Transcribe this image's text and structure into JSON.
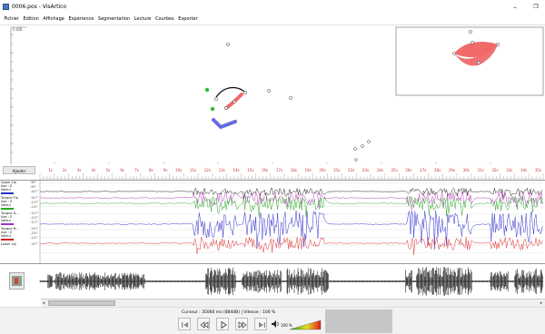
{
  "window": {
    "title": "0006.pos - VisArtico",
    "minimize_glyph": "–",
    "restore_glyph": "❐"
  },
  "menu": [
    {
      "label": "Fichier"
    },
    {
      "label": "Edition"
    },
    {
      "label": "Affichage"
    },
    {
      "label": "Expérience"
    },
    {
      "label": "Segmentation"
    },
    {
      "label": "Lecture"
    },
    {
      "label": "Courbes"
    },
    {
      "label": "Exporter"
    }
  ],
  "articulo": {
    "corner_labels": [
      "0.00",
      "1"
    ]
  },
  "timeline": {
    "add_button_label": "Ajouter",
    "ticks": [
      "1s",
      "2s",
      "3s",
      "4s",
      "5s",
      "6s",
      "7s",
      "8s",
      "9s",
      "10s",
      "11s",
      "12s",
      "13s",
      "14s",
      "15s",
      "16s",
      "17s",
      "18s",
      "19s",
      "20s",
      "21s",
      "22s",
      "23s",
      "24s",
      "25s",
      "26s",
      "27s",
      "28s",
      "29s",
      "30s",
      "31s",
      "32s",
      "33s",
      "34s",
      "35s"
    ]
  },
  "tracks": [
    {
      "label": "Upper Lip",
      "sub": "Axe : Z",
      "extra": "Valeur",
      "color": "#2233cc",
      "values": [
        "-98°",
        "-99°",
        "-101°"
      ]
    },
    {
      "label": "Tongue Tip",
      "sub": "Axe : Z",
      "extra": "Valeur",
      "color": "#22aa22",
      "values": [
        "-107°",
        "-113°",
        "-115°"
      ]
    },
    {
      "label": "Tongue D...",
      "sub": "Axe : Z",
      "extra": "Valeur",
      "color": "#9933cc",
      "values": [
        "-121°",
        "-123°",
        "-127°"
      ]
    },
    {
      "label": "Tongue B...",
      "sub": "Axe : Z",
      "extra": "Valeur",
      "color": "#cc2222",
      "values": [
        "-133°",
        "-135°",
        "-141°"
      ]
    },
    {
      "label": "Lower Lip",
      "sub": "",
      "extra": "",
      "color": "#cc2222",
      "values": [
        "-147°"
      ]
    }
  ],
  "status": {
    "cursor_label": "Curseur",
    "cursor_value": "35060 ms (884dB)",
    "speed_label": "Vitesse",
    "speed_value": "100 %",
    "volume_value": "100 %"
  },
  "colors": {
    "grid_label": "#cc3333",
    "lip_contour": "#f06a6a"
  }
}
